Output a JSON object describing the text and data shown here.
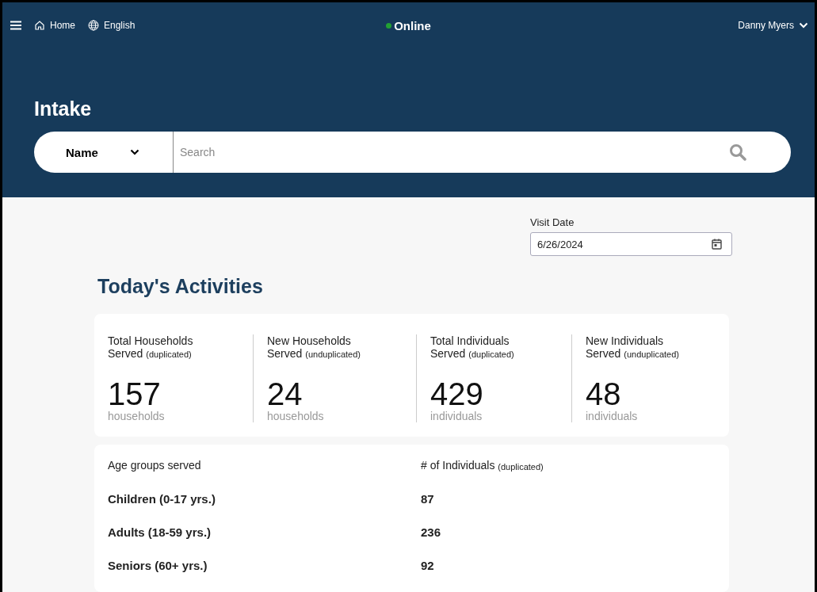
{
  "top_bar": {
    "home": "Home",
    "language": "English",
    "status": {
      "label": "Online",
      "color": "#22a033"
    },
    "user": "Danny Myers"
  },
  "page_title": "Intake",
  "search": {
    "filter": "Name",
    "placeholder": "Search"
  },
  "visit_date": {
    "label": "Visit Date",
    "value": "6/26/2024"
  },
  "section_title": "Today's Activities",
  "stats": [
    {
      "title": "Total Households Served",
      "qualifier": "(duplicated)",
      "value": "157",
      "unit": "households"
    },
    {
      "title": "New Households Served",
      "qualifier": "(unduplicated)",
      "value": "24",
      "unit": "households"
    },
    {
      "title": "Total Individuals Served",
      "qualifier": "(duplicated)",
      "value": "429",
      "unit": "individuals"
    },
    {
      "title": "New Individuals Served",
      "qualifier": "(unduplicated)",
      "value": "48",
      "unit": "individuals"
    }
  ],
  "age_table": {
    "columns": [
      {
        "label": "Age groups served"
      },
      {
        "label": "# of Individuals",
        "qualifier": "(duplicated)"
      }
    ],
    "rows": [
      [
        "Children (0-17 yrs.)",
        "87"
      ],
      [
        "Adults (18-59 yrs.)",
        "236"
      ],
      [
        "Seniors (60+ yrs.)",
        "92"
      ]
    ]
  }
}
